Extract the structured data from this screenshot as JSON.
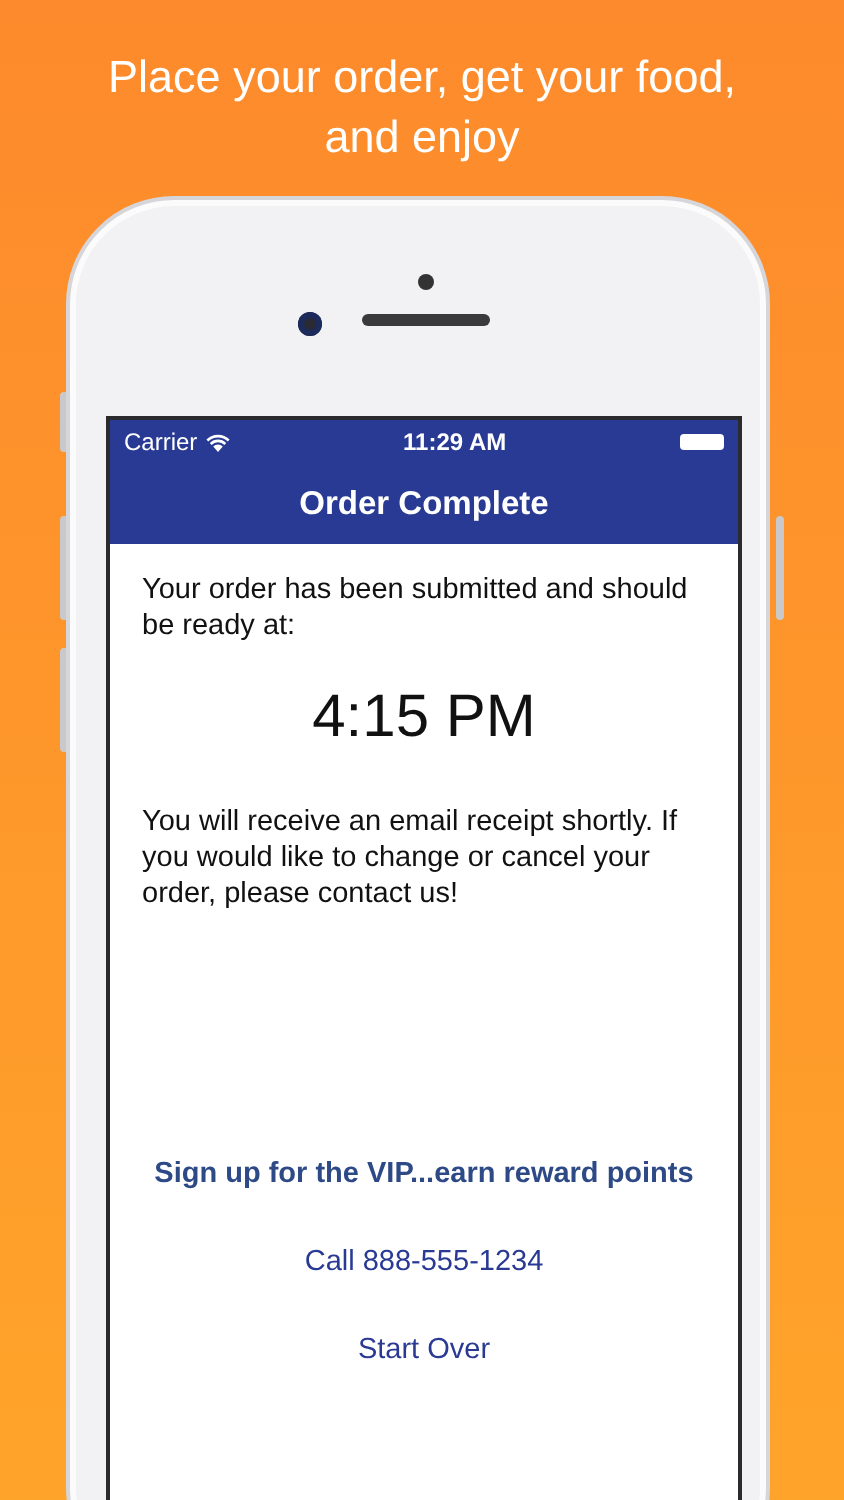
{
  "caption": "Place your order, get your food, and enjoy",
  "status_bar": {
    "carrier": "Carrier",
    "time": "11:29 AM"
  },
  "nav_title": "Order Complete",
  "message": "Your order has been submitted and should be ready at:",
  "ready_time": "4:15 PM",
  "note": "You will receive an email receipt shortly. If you would like to change or cancel your order, please contact us!",
  "links": [
    {
      "label": "Sign up for the VIP...earn reward points",
      "kind": "promo"
    },
    {
      "label": "Call 888-555-1234",
      "kind": "link"
    },
    {
      "label": "Start Over",
      "kind": "link"
    }
  ]
}
